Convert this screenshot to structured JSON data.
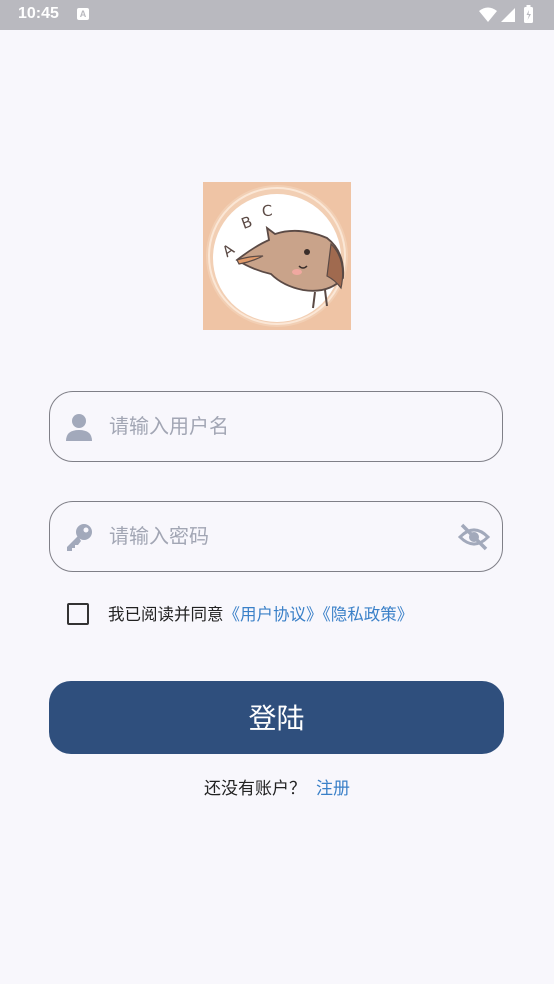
{
  "status_bar": {
    "time": "10:45",
    "notification_glyph": "A",
    "icons": [
      "wifi-icon",
      "signal-icon",
      "battery-icon"
    ]
  },
  "logo": {
    "letters": [
      "A",
      "B",
      "C"
    ]
  },
  "username": {
    "placeholder": "请输入用户名",
    "value": "",
    "icon": "person-icon"
  },
  "password": {
    "placeholder": "请输入密码",
    "value": "",
    "icon": "key-icon",
    "toggle_icon": "eye-off-icon"
  },
  "agreement": {
    "checked": false,
    "prefix": "我已阅读并同意",
    "user_agreement": "《用户协议》",
    "privacy_policy": "《隐私政策》"
  },
  "login_button": {
    "label": "登陆"
  },
  "register": {
    "prompt": "还没有账户？",
    "link": "注册"
  },
  "colors": {
    "background": "#f8f7fc",
    "primary_button": "#2f4f7d",
    "link": "#3a80c8",
    "placeholder": "#a2a6b4",
    "icon": "#a2a9bb",
    "status_bar": "#b9b9bf"
  }
}
